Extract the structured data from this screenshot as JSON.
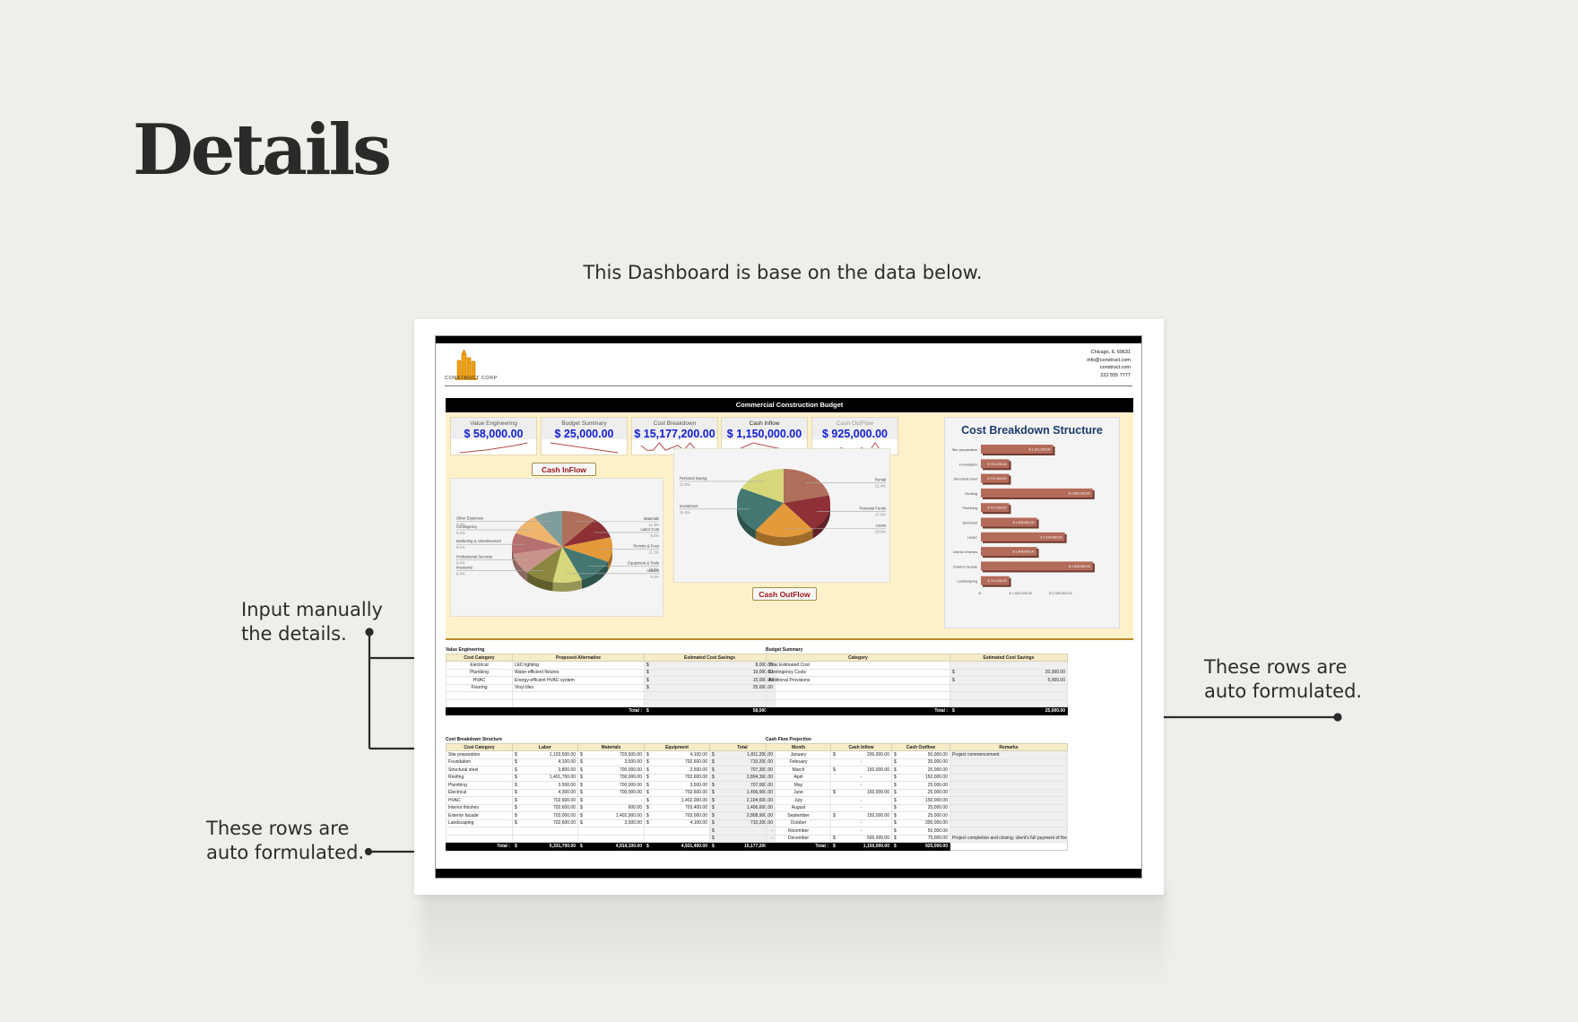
{
  "page": {
    "title": "Details",
    "caption": "This Dashboard is base on the data below.",
    "notes": {
      "input_manually": [
        "Input manually",
        "the details."
      ],
      "auto_left": [
        "These rows are",
        "auto formulated."
      ],
      "auto_right": [
        "These rows are",
        "auto formulated."
      ]
    }
  },
  "header": {
    "company": "CONSTRUCT CORP",
    "contact": [
      "Chicago, IL 60631",
      "info@construct.com",
      "construct.com",
      "222 555 7777"
    ],
    "brand_color": "#f0a10e"
  },
  "dashboard": {
    "title": "Commercial Construction Budget",
    "kpis": [
      {
        "label": "Value Engineering",
        "value": "$ 58,000.00",
        "trend": [
          1,
          2,
          3,
          4.5,
          6,
          8
        ]
      },
      {
        "label": "Budget Summary",
        "value": "$ 25,000.00",
        "trend": [
          6,
          4.5,
          3
        ]
      },
      {
        "label": "Cost Breakdown",
        "value": "$ 15,177,200.00",
        "trend": [
          4,
          2,
          2,
          5,
          2,
          3,
          4,
          2,
          5,
          2,
          1,
          1
        ]
      },
      {
        "label": "Cash Inflow",
        "value": "$ 1,150,000.00",
        "trend": [
          3,
          4,
          5,
          4.5,
          4,
          3.5,
          3
        ]
      },
      {
        "label": "Cash OutFlow",
        "value": "$ 925,000.00",
        "trend": [
          2,
          2,
          2,
          4,
          2,
          2,
          4,
          2,
          6,
          2,
          3
        ]
      }
    ],
    "cash_inflow_button": "Cash InFlow",
    "cash_outflow_button": "Cash OutFlow"
  },
  "chart_data": [
    {
      "type": "pie",
      "title": "Cash InFlow",
      "categories": [
        "Materials",
        "Labor Cost",
        "Permits & Fees",
        "Equipment & Tools",
        "Utilities",
        "Insurance",
        "Professional Services",
        "Marketing & Advertisement",
        "Contingency",
        "Other Expenses"
      ],
      "values": [
        11.3,
        9.4,
        11.1,
        11.8,
        9.4,
        9.4,
        9.4,
        9.4,
        9.4,
        9.4
      ],
      "labels": [
        "11.3%",
        "9.4%",
        "11.1%",
        "11.8%",
        "9.4%",
        "9.4%",
        "9.4%",
        "9.4%",
        "9.4%",
        "9.4%"
      ],
      "colors": [
        "#b06f5a",
        "#8e3035",
        "#e49a3a",
        "#43776f",
        "#d6d77a",
        "#8b8741",
        "#c8938a",
        "#b66f6f",
        "#efb56f",
        "#7f9e9b"
      ]
    },
    {
      "type": "pie",
      "title": "Cash OutFlow",
      "categories": [
        "Rental",
        "Personal Funds",
        "Loans",
        "Investment",
        "Personal Saving"
      ],
      "values": [
        21.4,
        17.9,
        20.9,
        21.9,
        17.9
      ],
      "labels": [
        "21.4%",
        "17.9%",
        "20.9%",
        "21.9%",
        "17.9%"
      ],
      "colors": [
        "#b06f5a",
        "#8e3035",
        "#e49a3a",
        "#43776f",
        "#d6d77a"
      ]
    },
    {
      "type": "bar",
      "title": "Cost Breakdown Structure",
      "categories": [
        "Site preparation",
        "Foundation",
        "Structural steel",
        "Roofing",
        "Plumbing",
        "Electrical",
        "HVAC",
        "Interior finishes",
        "Exterior facade",
        "Landscaping"
      ],
      "values": [
        1811200,
        710200,
        707300,
        2804300,
        707000,
        1406900,
        2104600,
        1406600,
        2808900,
        710200
      ],
      "value_labels": [
        "$ 1,811,200.00",
        "$ 710,200.00",
        "$ 707,300.00",
        "$ 2,804,300.00",
        "$ 707,000.00",
        "$ 1,406,900.00",
        "$ 2,104,600.00",
        "$ 1,406,600.00",
        "$ 2,808,900.00",
        "$ 710,200.00"
      ],
      "x_ticks": [
        "$ -",
        "$ 1,000,000.00",
        "$ 2,000,000.00"
      ],
      "xlim": [
        0,
        3000000
      ],
      "color": "#b36b5a"
    }
  ],
  "value_engineering": {
    "title": "Value Engineering",
    "columns": [
      "Cost Category",
      "Proposed Alternative",
      "Estimated Cost Savings"
    ],
    "rows": [
      {
        "category": "Electrical",
        "alternative": "LED lighting",
        "savings": "8,000.00"
      },
      {
        "category": "Plumbing",
        "alternative": "Water-efficient fixtures",
        "savings": "10,000.00"
      },
      {
        "category": "HVAC",
        "alternative": "Energy-efficient HVAC system",
        "savings": "15,000.00"
      },
      {
        "category": "Flooring",
        "alternative": "Vinyl tiles",
        "savings": "25,000.00"
      }
    ],
    "total_label": "Total :",
    "total": "58,000.00"
  },
  "budget_summary": {
    "title": "Budget Summary",
    "columns": [
      "Category",
      "Estimated Cost Savings"
    ],
    "rows": [
      {
        "category": "Total Estimated Cost",
        "value": ""
      },
      {
        "category": "Contingency Costs",
        "value": "20,000.00"
      },
      {
        "category": "Additional Provisions",
        "value": "5,000.00"
      }
    ],
    "total_label": "Total :",
    "total": "25,000.00"
  },
  "cost_breakdown": {
    "title": "Cost Breakdown Structure",
    "columns": [
      "Cost Category",
      "Labor",
      "Materials",
      "Equipment",
      "Total"
    ],
    "rows": [
      [
        "Site preparation",
        "1,103,500.00",
        "703,600.00",
        "4,100.00",
        "1,811,200.00"
      ],
      [
        "Foundation",
        "4,100.00",
        "3,500.00",
        "702,600.00",
        "710,200.00"
      ],
      [
        "Structural steel",
        "3,800.00",
        "700,000.00",
        "3,500.00",
        "707,300.00"
      ],
      [
        "Roofing",
        "1,401,700.00",
        "700,000.00",
        "702,600.00",
        "2,804,300.00"
      ],
      [
        "Plumbing",
        "3,500.00",
        "700,000.00",
        "3,500.00",
        "707,000.00"
      ],
      [
        "Electrical",
        "4,300.00",
        "700,000.00",
        "702,600.00",
        "1,406,900.00"
      ],
      [
        "HVAC",
        "702,600.00",
        "-",
        "1,402,000.00",
        "2,104,600.00"
      ],
      [
        "Interior finishes",
        "702,600.00",
        "600.00",
        "703,400.00",
        "1,406,600.00"
      ],
      [
        "Exterior facade",
        "703,000.00",
        "1,402,900.00",
        "703,000.00",
        "2,808,900.00"
      ],
      [
        "Landscaping",
        "702,600.00",
        "3,500.00",
        "4,100.00",
        "710,200.00"
      ]
    ],
    "total_label": "Total :",
    "totals": [
      "5,331,700.00",
      "4,914,100.00",
      "4,931,400.00",
      "15,177,200.00"
    ]
  },
  "cash_flow": {
    "title": "Cash Flow Projection",
    "columns": [
      "Month",
      "Cash Inflow",
      "Cash Outflow",
      "Remarks"
    ],
    "rows": [
      [
        "January",
        "200,000.00",
        "50,000.00",
        "Project commencement"
      ],
      [
        "February",
        "-",
        "25,000.00",
        ""
      ],
      [
        "March",
        "150,000.00",
        "25,000.00",
        ""
      ],
      [
        "April",
        "-",
        "150,000.00",
        ""
      ],
      [
        "May",
        "-",
        "25,000.00",
        ""
      ],
      [
        "June",
        "150,000.00",
        "25,000.00",
        ""
      ],
      [
        "July",
        "-",
        "150,000.00",
        ""
      ],
      [
        "August",
        "-",
        "25,000.00",
        ""
      ],
      [
        "September",
        "150,000.00",
        "25,000.00",
        ""
      ],
      [
        "October",
        "-",
        "300,000.00",
        ""
      ],
      [
        "November",
        "-",
        "50,000.00",
        ""
      ],
      [
        "December",
        "500,000.00",
        "75,000.00",
        "Project completion and closing; client's full payment of the remaining"
      ]
    ],
    "total_label": "Total :",
    "totals": [
      "1,150,000.00",
      "925,000.00"
    ]
  }
}
